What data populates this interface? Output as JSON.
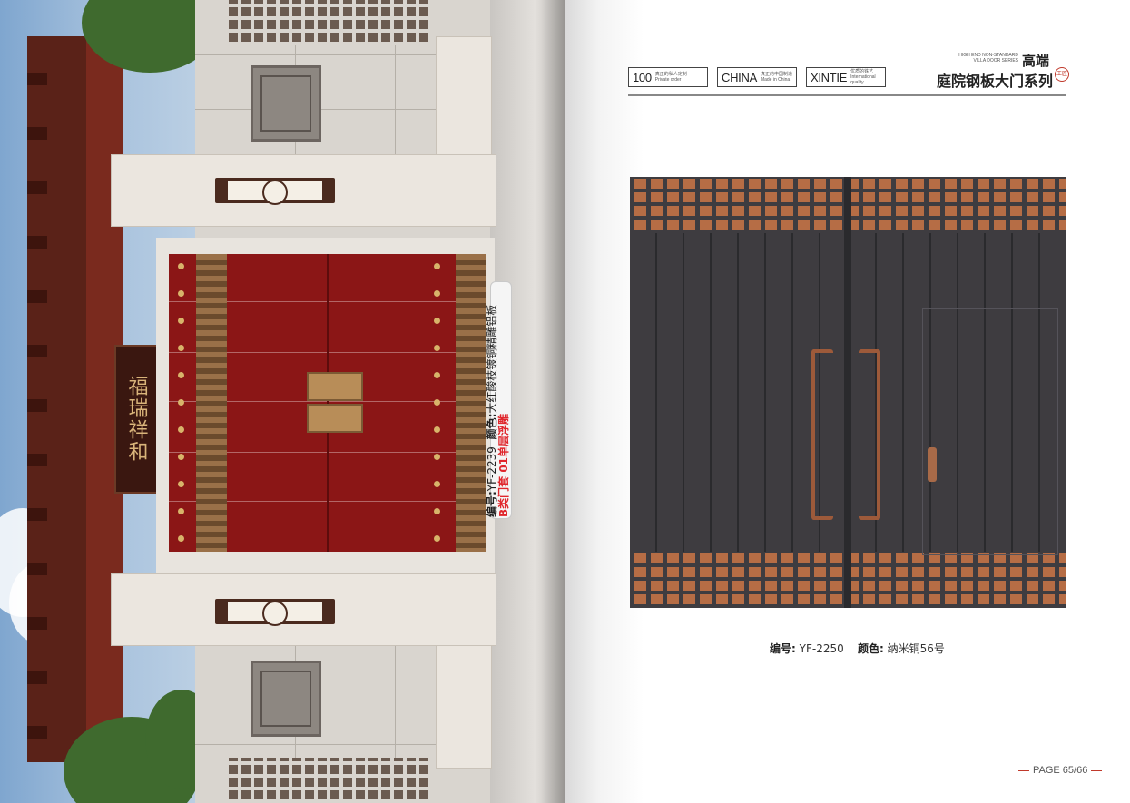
{
  "left_page": {
    "sign_board_text": "福瑞祥和",
    "caption": {
      "code_label": "编号:",
      "code_value": "YF-2239",
      "color_label": "颜色:",
      "color_value": "大红酸枝镀铜精雕铝板",
      "type_line": "B类门套 01单层浮雕"
    }
  },
  "right_page": {
    "badges": [
      {
        "big": "100",
        "small": "真正的私人定制\nPrivate order"
      },
      {
        "big": "CHINA",
        "small": "真正的中国制造\nMade in China"
      },
      {
        "big": "XINTIE",
        "small": "优质的铁艺\nInternational quality"
      }
    ],
    "brand": {
      "tiny_line1": "HIGH END NON-STANDARD",
      "tiny_line2": "VILLA DOOR SERIES",
      "gaoduan": "高端",
      "series": "庭院钢板大门系列",
      "seal": "工匠"
    },
    "door_caption": {
      "code_label": "编号:",
      "code_value": "YF-2250",
      "color_label": "颜色:",
      "color_value": "纳米铜56号"
    },
    "page_number": "PAGE 65/66"
  }
}
